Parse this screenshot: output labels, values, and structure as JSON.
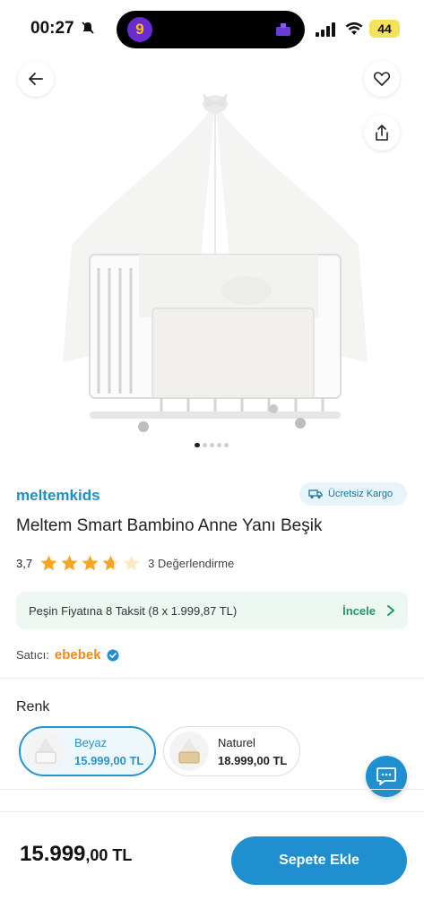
{
  "status_bar": {
    "time": "00:27",
    "battery": "44",
    "island_app_glyph": "9"
  },
  "product": {
    "brand": "meltemkids",
    "shipping_badge": "Ücretsiz Kargo",
    "title": "Meltem Smart Bambino Anne Yanı Beşik",
    "rating": "3,7",
    "rating_value": 3.7,
    "rating_max": 5,
    "review_count": "3 Değerlendirme",
    "image_count": 5,
    "active_image_index": 0
  },
  "installment": {
    "text": "Peşin Fiyatına 8 Taksit (8 x 1.999,87 TL)",
    "link": "İncele"
  },
  "seller": {
    "label": "Satıcı:",
    "name": "ebebek"
  },
  "color_section": {
    "title": "Renk",
    "options": [
      {
        "name": "Beyaz",
        "price": "15.999,00 TL",
        "selected": true
      },
      {
        "name": "Naturel",
        "price": "18.999,00 TL",
        "selected": false
      }
    ]
  },
  "bottom_bar": {
    "price_main": "15.999",
    "price_sub": ",00 TL",
    "cart_button": "Sepete Ekle"
  },
  "colors": {
    "accent_blue": "#1f8fd0",
    "brand_blue": "#1f8fc0",
    "seller_orange": "#f08a1c",
    "star_orange": "#f5a623",
    "installment_green": "#1e9a6a"
  },
  "icons": {
    "back": "arrow-left-icon",
    "favorite": "heart-icon",
    "share": "share-icon",
    "shipping": "truck-icon",
    "verified": "verified-check-icon",
    "chat": "chat-bubble-icon"
  }
}
